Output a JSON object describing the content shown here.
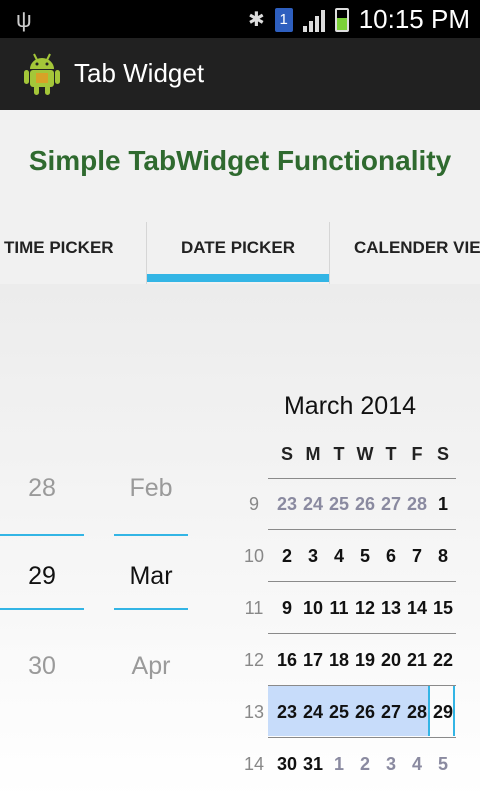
{
  "status_bar": {
    "usb_icon": "usb-icon",
    "bluetooth_icon": "bluetooth-icon",
    "sim_label": "1",
    "time": "10:15 PM"
  },
  "action_bar": {
    "title": "Tab Widget",
    "icon": "android-robot-icon"
  },
  "heading": "Simple TabWidget Functionality",
  "tabs": [
    {
      "label": "TIME PICKER"
    },
    {
      "label": "DATE PICKER"
    },
    {
      "label": "CALENDER VIEW"
    }
  ],
  "date_picker": {
    "day": {
      "prev": "28",
      "current": "29",
      "next": "30"
    },
    "month": {
      "prev": "Feb",
      "current": "Mar",
      "next": "Apr"
    }
  },
  "calendar": {
    "title": "March 2014",
    "weekdays": [
      "S",
      "M",
      "T",
      "W",
      "T",
      "F",
      "S"
    ],
    "weeks": [
      {
        "num": "9",
        "days": [
          "23",
          "24",
          "25",
          "26",
          "27",
          "28",
          "1"
        ]
      },
      {
        "num": "10",
        "days": [
          "2",
          "3",
          "4",
          "5",
          "6",
          "7",
          "8"
        ]
      },
      {
        "num": "11",
        "days": [
          "9",
          "10",
          "11",
          "12",
          "13",
          "14",
          "15"
        ]
      },
      {
        "num": "12",
        "days": [
          "16",
          "17",
          "18",
          "19",
          "20",
          "21",
          "22"
        ]
      },
      {
        "num": "13",
        "days": [
          "23",
          "24",
          "25",
          "26",
          "27",
          "28",
          "29"
        ]
      },
      {
        "num": "14",
        "days": [
          "30",
          "31",
          "1",
          "2",
          "3",
          "4",
          "5"
        ]
      }
    ]
  },
  "colors": {
    "accent": "#33b5e5",
    "heading": "#2f6a2f",
    "selection": "#c7dcfa"
  }
}
